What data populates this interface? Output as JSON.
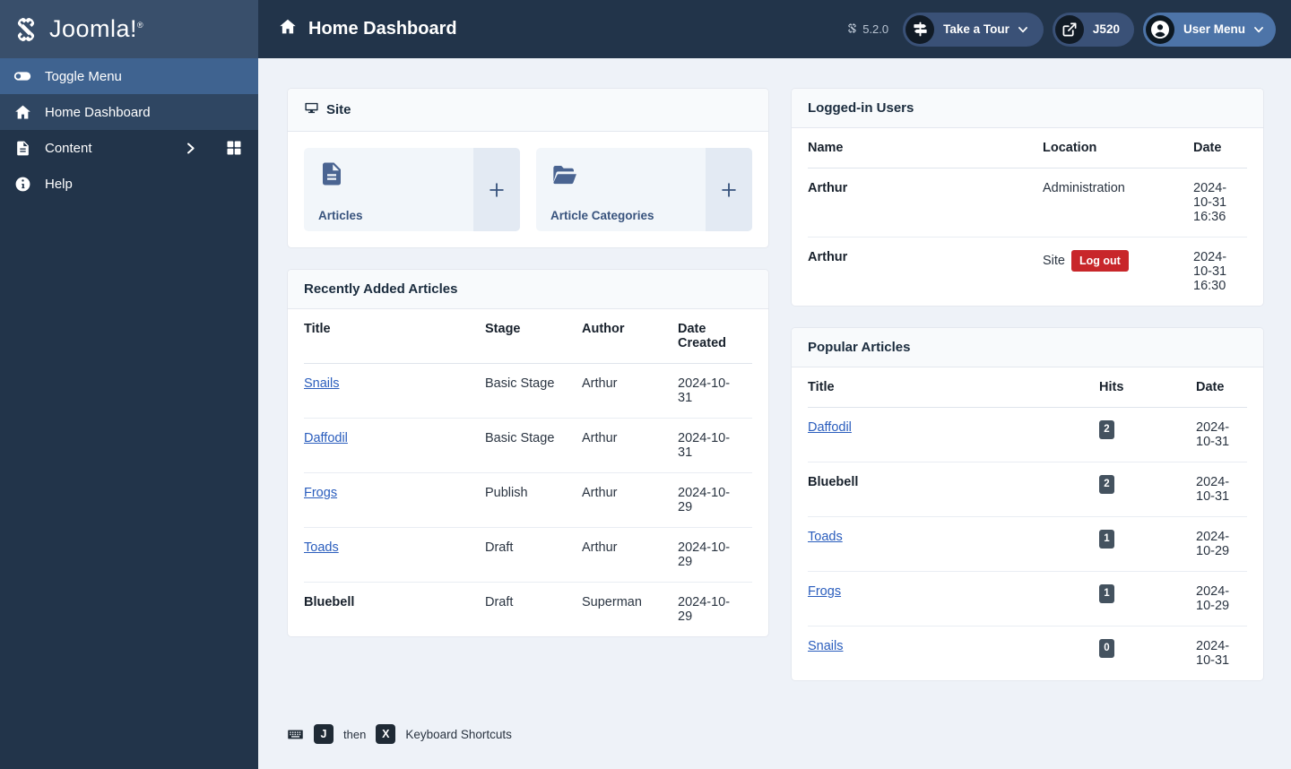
{
  "brand": {
    "name": "Joomla!",
    "logo_icon": "joomla-logo-icon",
    "trademark": "®"
  },
  "sidebar": {
    "items": [
      {
        "label": "Toggle Menu",
        "icon": "toggle-switch-icon",
        "state": "toggle"
      },
      {
        "label": "Home Dashboard",
        "icon": "home-icon",
        "state": "active"
      },
      {
        "label": "Content",
        "icon": "document-icon",
        "state": "normal",
        "has_chevron": true,
        "has_grid": true
      },
      {
        "label": "Help",
        "icon": "info-circle-icon",
        "state": "normal"
      }
    ]
  },
  "header": {
    "title": "Home Dashboard",
    "title_icon": "home-icon",
    "version_label": "5.2.0",
    "version_icon": "joomla-mark-icon",
    "buttons": [
      {
        "label": "Take a Tour",
        "icon": "signpost-icon",
        "caret": true,
        "name": "take-a-tour-button"
      },
      {
        "label": "J520",
        "icon": "external-link-icon",
        "caret": false,
        "name": "preview-site-button"
      },
      {
        "label": "User Menu",
        "icon": "user-circle-icon",
        "caret": true,
        "name": "user-menu-button"
      }
    ]
  },
  "site_panel": {
    "title": "Site",
    "icon": "monitor-icon",
    "tiles": [
      {
        "label": "Articles",
        "icon": "document-icon",
        "add_icon": "plus-icon"
      },
      {
        "label": "Article Categories",
        "icon": "folder-open-icon",
        "add_icon": "plus-icon"
      }
    ]
  },
  "recently_added": {
    "title": "Recently Added Articles",
    "columns": [
      "Title",
      "Stage",
      "Author",
      "Date Created"
    ],
    "rows": [
      {
        "title": "Snails",
        "link": true,
        "stage": "Basic Stage",
        "author": "Arthur",
        "date": "2024-10-31"
      },
      {
        "title": "Daffodil",
        "link": true,
        "stage": "Basic Stage",
        "author": "Arthur",
        "date": "2024-10-31"
      },
      {
        "title": "Frogs",
        "link": true,
        "stage": "Publish",
        "author": "Arthur",
        "date": "2024-10-29"
      },
      {
        "title": "Toads",
        "link": true,
        "stage": "Draft",
        "author": "Arthur",
        "date": "2024-10-29"
      },
      {
        "title": "Bluebell",
        "link": false,
        "stage": "Draft",
        "author": "Superman",
        "date": "2024-10-29"
      }
    ]
  },
  "logged_in_users": {
    "title": "Logged-in Users",
    "columns": [
      "Name",
      "Location",
      "Date"
    ],
    "rows": [
      {
        "name": "Arthur",
        "location": "Administration",
        "logout": null,
        "date": "2024-10-31 16:36"
      },
      {
        "name": "Arthur",
        "location": "Site",
        "logout": "Log out",
        "date": "2024-10-31 16:30"
      }
    ]
  },
  "popular_articles": {
    "title": "Popular Articles",
    "columns": [
      "Title",
      "Hits",
      "Date"
    ],
    "rows": [
      {
        "title": "Daffodil",
        "link": true,
        "hits": "2",
        "date": "2024-10-31"
      },
      {
        "title": "Bluebell",
        "link": false,
        "hits": "2",
        "date": "2024-10-31"
      },
      {
        "title": "Toads",
        "link": true,
        "hits": "1",
        "date": "2024-10-29"
      },
      {
        "title": "Frogs",
        "link": true,
        "hits": "1",
        "date": "2024-10-29"
      },
      {
        "title": "Snails",
        "link": true,
        "hits": "0",
        "date": "2024-10-31"
      }
    ]
  },
  "footer": {
    "keyboard_icon": "keyboard-icon",
    "key1": "J",
    "then": "then",
    "key2": "X",
    "label": "Keyboard Shortcuts"
  },
  "colors": {
    "sidebar_bg": "#22344a",
    "sidebar_brand_bg": "#394f6b",
    "sidebar_toggle_bg": "#3f6390",
    "sidebar_active_bg": "#2f4662",
    "page_bg": "#eef2f8",
    "link": "#2a5dbd",
    "danger": "#c8262a",
    "badge": "#44525f",
    "tile_bg": "#f2f6fa",
    "tile_plus_bg": "#e3eaf3",
    "accent_pill": "#3a5177",
    "accent_pill_user": "#4d74a8"
  }
}
